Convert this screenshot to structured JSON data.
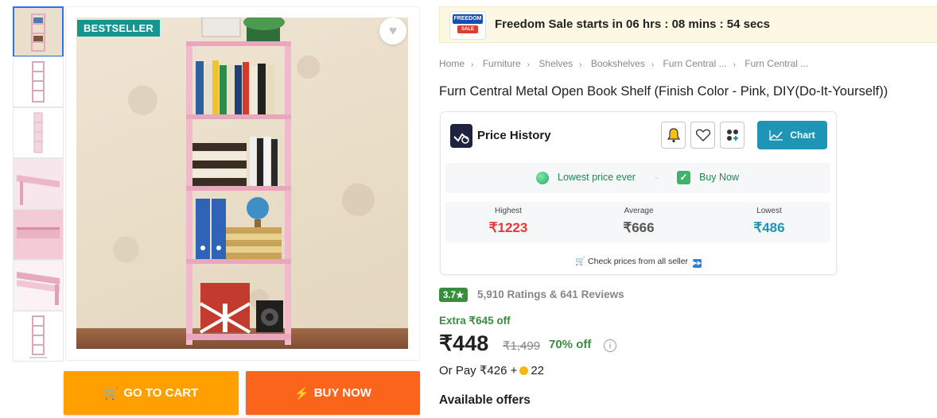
{
  "product_images": {
    "badge": "BESTSELLER",
    "thumbnail_count": 7,
    "active_thumbnail": 1
  },
  "actions": {
    "go_to_cart": "GO TO CART",
    "buy_now": "BUY NOW"
  },
  "sale_banner": {
    "logo_line1": "FREEDOM",
    "logo_line2": "SALE",
    "text": "Freedom Sale starts in 06 hrs : 08 mins : 54 secs"
  },
  "breadcrumb": [
    "Home",
    "Furniture",
    "Shelves",
    "Bookshelves",
    "Furn Central ...",
    "Furn Central ..."
  ],
  "product": {
    "title": "Furn Central Metal Open Book Shelf  (Finish Color - Pink, DIY(Do-It-Yourself))"
  },
  "price_history": {
    "title": "Price History",
    "chart_label": "Chart",
    "lowest_ever": "Lowest price ever",
    "separator": "-",
    "buy_now": "Buy Now",
    "highest_label": "Highest",
    "highest_value": "₹1223",
    "average_label": "Average",
    "average_value": "₹666",
    "lowest_label": "Lowest",
    "lowest_value": "₹486",
    "check_prices": "Check prices from all seller"
  },
  "rating": {
    "score": "3.7★",
    "summary": "5,910 Ratings & 641 Reviews"
  },
  "pricing": {
    "extra_off": "Extra ₹645 off",
    "price": "₹448",
    "mrp": "₹1,499",
    "discount": "70% off",
    "or_pay_prefix": "Or Pay ₹426 +",
    "coins": "22"
  },
  "offers": {
    "heading": "Available offers"
  },
  "colors": {
    "accent_blue": "#2874f0",
    "badge_teal": "#14958f",
    "cart_orange": "#ff9f00",
    "buy_orange": "#fb641b",
    "green": "#388e3c",
    "highest_red": "#e53935",
    "lowest_teal": "#1f95b5"
  }
}
